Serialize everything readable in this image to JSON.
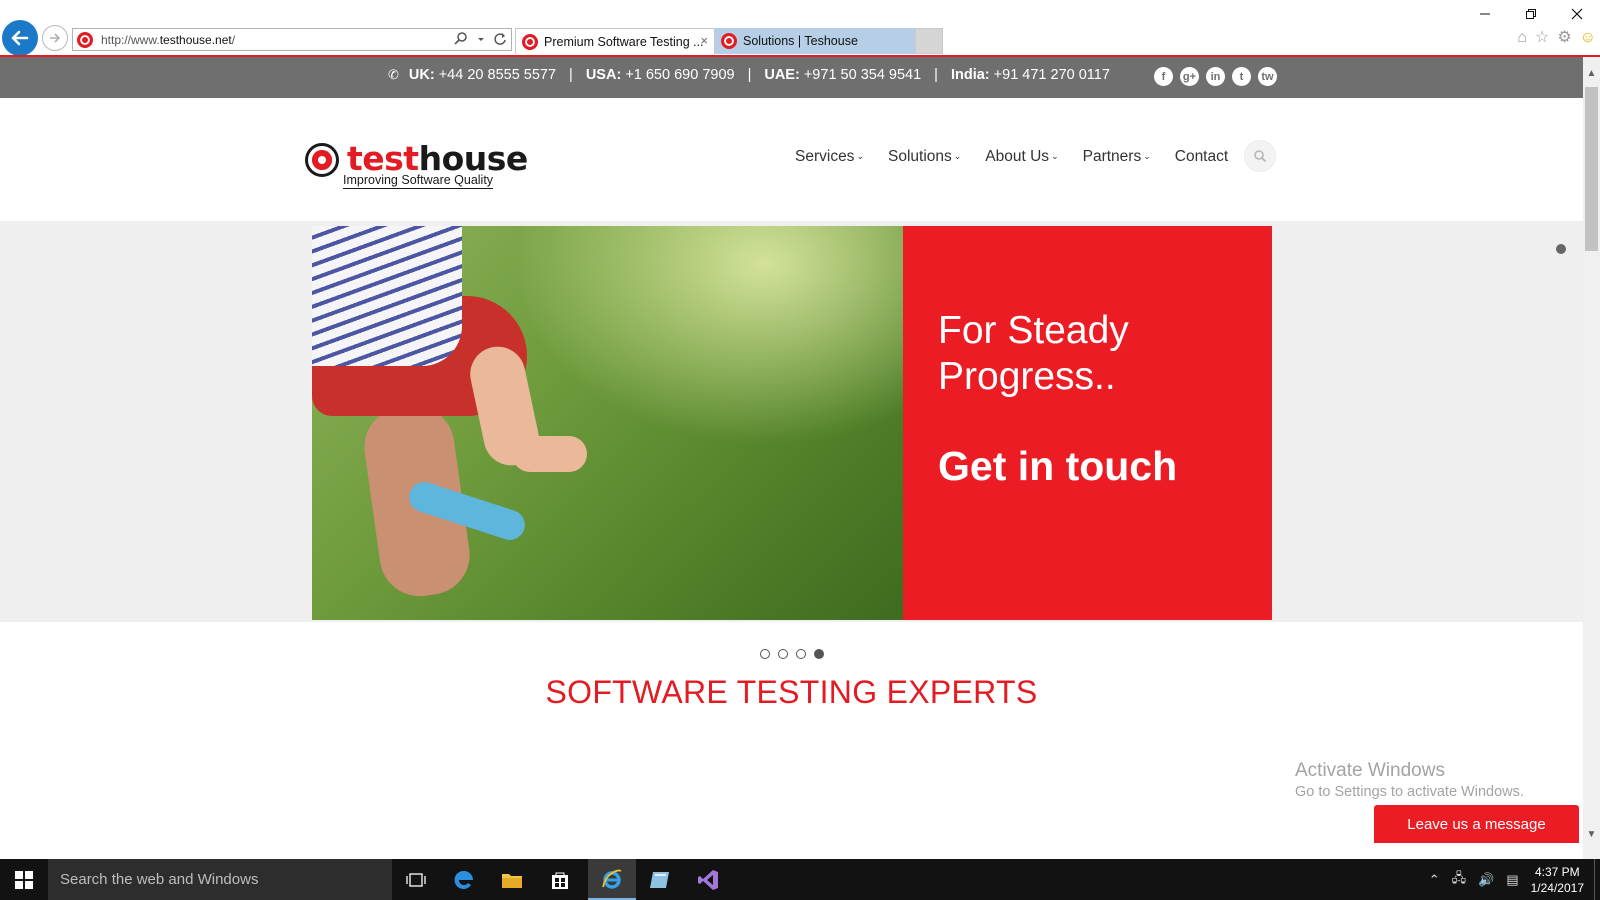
{
  "browser": {
    "url_prefix": "http://www.",
    "url_domain": "testhouse.net",
    "url_suffix": "/",
    "tabs": [
      {
        "label": "Premium Software Testing ..."
      },
      {
        "label": "Solutions | Teshouse"
      }
    ],
    "close_glyph": "×"
  },
  "topbar": {
    "uk_label": "UK:",
    "uk_number": "+44 20 8555 5577",
    "usa_label": "USA:",
    "usa_number": "+1 650 690 7909",
    "uae_label": "UAE:",
    "uae_number": "+971 50 354 9541",
    "india_label": "India:",
    "india_number": "+91 471 270 0117",
    "separator": "|",
    "socials": [
      "f",
      "g+",
      "in",
      "t",
      "tw"
    ]
  },
  "logo": {
    "word_a": "test",
    "word_b": "house",
    "tagline": "Improving Software Quality"
  },
  "nav": {
    "items": [
      {
        "label": "Services",
        "chevron": "⌄"
      },
      {
        "label": "Solutions",
        "chevron": "⌄"
      },
      {
        "label": "About Us",
        "chevron": "⌄"
      },
      {
        "label": "Partners",
        "chevron": "⌄"
      },
      {
        "label": "Contact",
        "chevron": ""
      }
    ]
  },
  "hero": {
    "tagline": "For Steady Progress..",
    "cta": "Get in touch",
    "slides_total": 4,
    "active_slide": 4
  },
  "section": {
    "title": "SOFTWARE TESTING EXPERTS"
  },
  "watermark": {
    "line1": "Activate Windows",
    "line2": "Go to Settings to activate Windows."
  },
  "chat": {
    "label": "Leave us a message"
  },
  "taskbar": {
    "search_placeholder": "Search the web and Windows",
    "time": "4:37 PM",
    "date": "1/24/2017"
  },
  "colors": {
    "brand_red": "#ec1c24",
    "topbar_gray": "#6f6f6f",
    "browser_blue": "#1c79c7"
  }
}
